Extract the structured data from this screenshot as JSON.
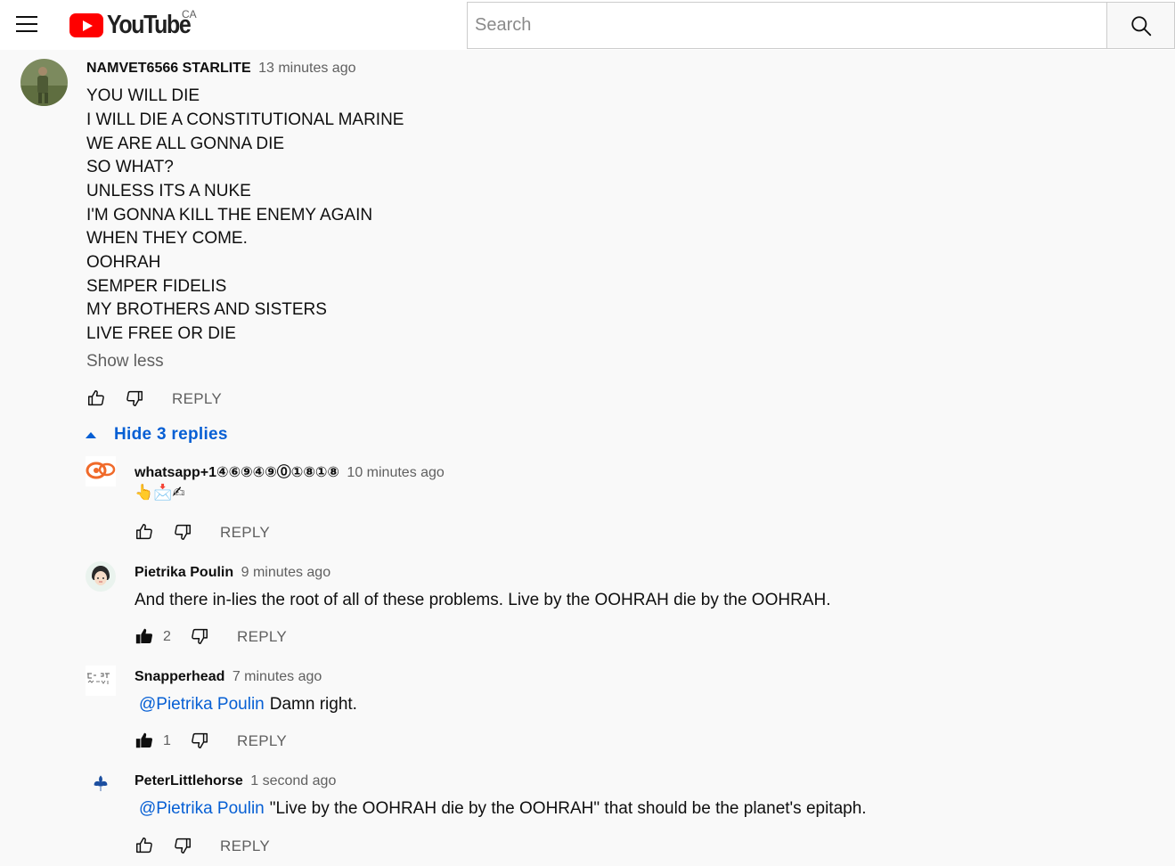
{
  "header": {
    "menu_icon": "hamburger-menu-icon",
    "logo_text": "YouTube",
    "country": "CA",
    "search_placeholder": "Search",
    "search_icon": "search-icon"
  },
  "comment": {
    "author": "NAMVET6566 STARLITE",
    "time": "13 minutes ago",
    "lines": [
      "YOU WILL DIE",
      "I WILL DIE A CONSTITUTIONAL MARINE",
      "WE ARE ALL GONNA DIE",
      "SO WHAT?",
      "UNLESS ITS A NUKE",
      "I'M GONNA KILL THE ENEMY AGAIN",
      "WHEN THEY COME.",
      "OOHRAH",
      "SEMPER FIDELIS",
      "MY BROTHERS AND SISTERS",
      "LIVE FREE OR DIE"
    ],
    "show_less": "Show less",
    "reply_label": "REPLY",
    "hide_replies": "Hide 3 replies"
  },
  "replies": [
    {
      "author": "whatsapp+1④⑥⑨④⑨⓪①⑧①⑧",
      "time": "10 minutes ago",
      "mention": "",
      "text": "👆📩✍",
      "likes": "",
      "reply_label": "REPLY"
    },
    {
      "author": "Pietrika Poulin",
      "time": "9 minutes ago",
      "mention": "",
      "text": "And there in-lies the root of all of these problems. Live by the OOHRAH die by the OOHRAH.",
      "likes": "2",
      "reply_label": "REPLY"
    },
    {
      "author": "Snapperhead",
      "time": "7 minutes ago",
      "mention": "@Pietrika Poulin",
      "text": "Damn right.",
      "likes": "1",
      "reply_label": "REPLY"
    },
    {
      "author": "PeterLittlehorse",
      "time": "1 second ago",
      "mention": "@Pietrika Poulin",
      "text": "\"Live by the OOHRAH die by the OOHRAH\" that should be the planet's epitaph.",
      "likes": "",
      "reply_label": "REPLY"
    }
  ],
  "colors": {
    "link_blue": "#065fd4",
    "secondary_text": "#606060",
    "logo_red": "#ff0000",
    "page_bg": "#f9f9f9"
  }
}
